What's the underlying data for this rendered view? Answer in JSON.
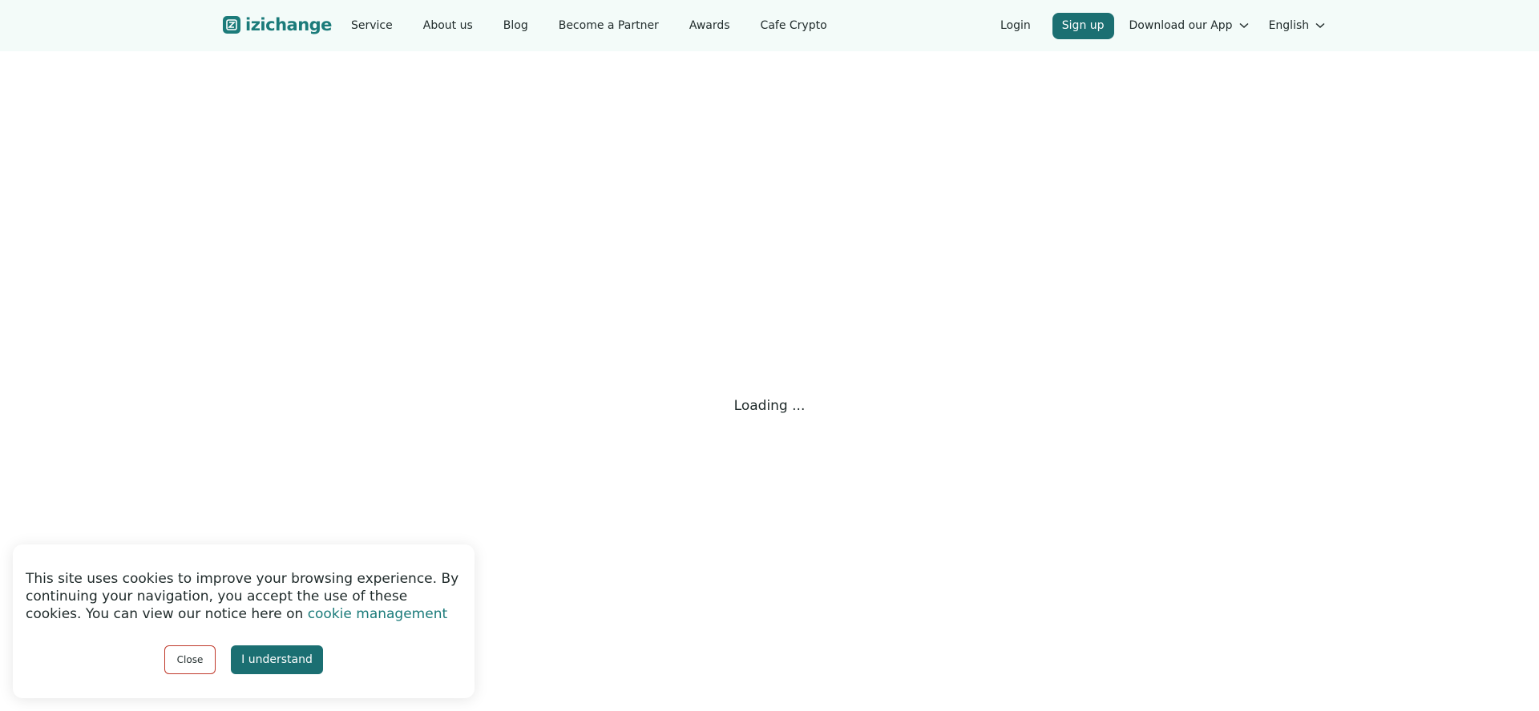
{
  "header": {
    "logo_text": "izichange",
    "nav": [
      "Service",
      "About us",
      "Blog",
      "Become a Partner",
      "Awards",
      "Cafe Crypto"
    ],
    "login_label": "Login",
    "signup_label": "Sign up",
    "download_label": "Download our App",
    "language_label": "English"
  },
  "main": {
    "loading_text": "Loading ..."
  },
  "cookie_banner": {
    "message": "This site uses cookies to improve your browsing experience. By continuing your navigation, you accept the use of these cookies. You can view our notice here on",
    "link_text": "cookie management",
    "close_label": "Close",
    "accept_label": "I understand"
  },
  "colors": {
    "brand": "#1b7b7a",
    "button": "#1b6f72",
    "header_bg": "#f3fbf9",
    "close_border": "#c0392b"
  }
}
